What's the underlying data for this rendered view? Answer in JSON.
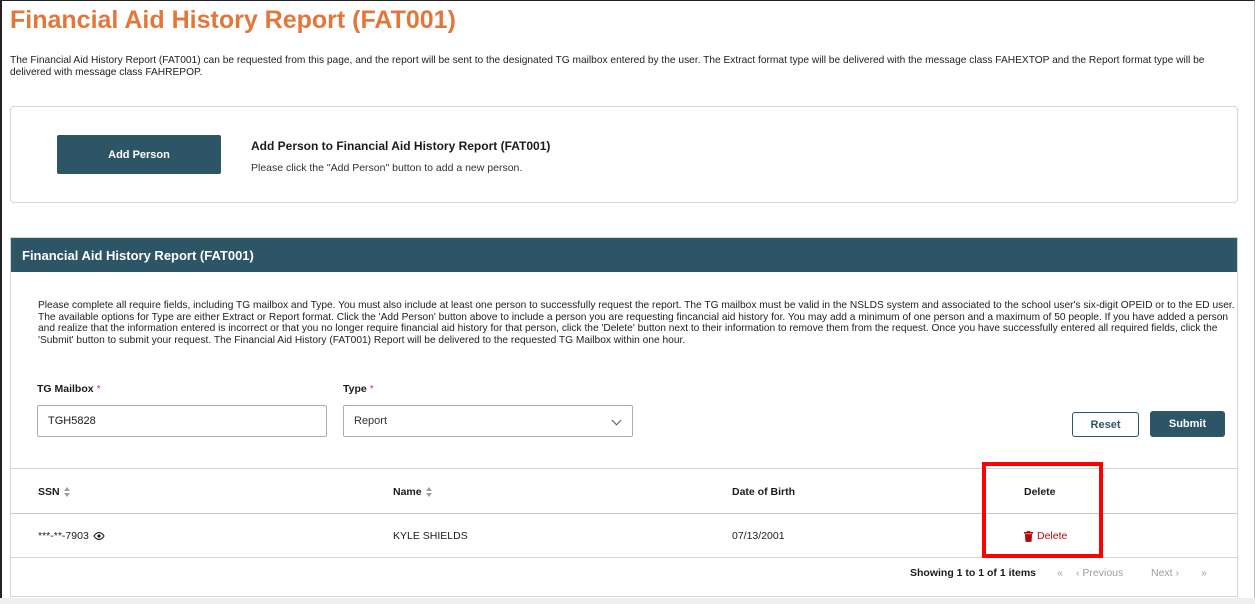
{
  "page": {
    "title": "Financial Aid History Report (FAT001)",
    "intro": "The Financial Aid History Report (FAT001) can be requested from this page, and the report will be sent to the designated TG mailbox entered by the user. The Extract format type will be delivered with the message class FAHEXTOP and the Report format type will be delivered with message class FAHREPOP."
  },
  "add_person": {
    "button_label": "Add Person",
    "heading": "Add Person to Financial Aid History Report (FAT001)",
    "subtext": "Please click the \"Add Person\" button to add a new person."
  },
  "report": {
    "header": "Financial Aid History Report (FAT001)",
    "instructions": "Please complete all require fields, including TG mailbox and Type. You must also include at least one person to successfully request the report. The TG mailbox must be valid in the NSLDS system and associated to the school user's six-digit OPEID or to the ED user. The available options for Type are either Extract or Report format. Click the 'Add Person' button above to include a person you are requesting fincancial aid history for. You may add a minimum of one person and a maximum of 50 people. If you have added a person and realize that the information entered is incorrect or that you no longer require financial aid history for that person, click the 'Delete' button next to their information to remove them from the request. Once you have successfully entered all required fields, click the 'Submit' button to submit your request. The Financial Aid History (FAT001) Report will be delivered to the requested TG Mailbox within one hour.",
    "mailbox_label": "TG Mailbox",
    "mailbox_value": "TGH5828",
    "type_label": "Type",
    "type_value": "Report",
    "required_mark": "*",
    "reset_label": "Reset",
    "submit_label": "Submit"
  },
  "table": {
    "columns": [
      "SSN",
      "Name",
      "Date of Birth",
      "Delete"
    ],
    "rows": [
      {
        "ssn": "***-**-7903",
        "name": "KYLE SHIELDS",
        "dob": "07/13/2001",
        "delete_label": "Delete"
      }
    ]
  },
  "pagination": {
    "showing": "Showing 1 to 1 of 1 items",
    "first": "«",
    "prev": "‹ Previous",
    "next": "Next ›",
    "last": "»"
  },
  "colors": {
    "title_orange": "#e3773a",
    "header_teal": "#2d5565",
    "delete_red": "#b50909",
    "highlight_red": "#ff0000"
  }
}
